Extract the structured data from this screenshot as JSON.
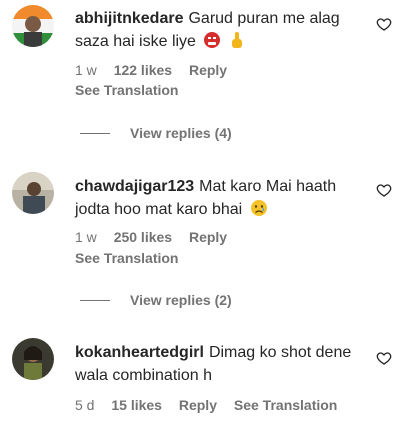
{
  "comments": [
    {
      "username": "abhijitnkedare",
      "text": "Garud puran me alag saza hai iske liye",
      "emojis": [
        "angry-face-emoji",
        "middle-finger-emoji"
      ],
      "time": "1 w",
      "likes": "122 likes",
      "reply": "Reply",
      "see_translation": "See Translation",
      "view_replies": "View replies (4)"
    },
    {
      "username": "chawdajigar123",
      "text": "Mat karo Mai haath jodta hoo mat karo bhai",
      "emojis": [
        "sad-face-emoji"
      ],
      "time": "1 w",
      "likes": "250 likes",
      "reply": "Reply",
      "see_translation": "See Translation",
      "view_replies": "View replies (2)"
    },
    {
      "username": "kokanheartedgirl",
      "text": "Dimag ko shot dene wala combination h",
      "time": "5 d",
      "likes": "15 likes",
      "reply": "Reply",
      "see_translation": "See Translation"
    }
  ],
  "colors": {
    "text": "#262626",
    "muted": "#737373",
    "background": "#ffffff"
  }
}
